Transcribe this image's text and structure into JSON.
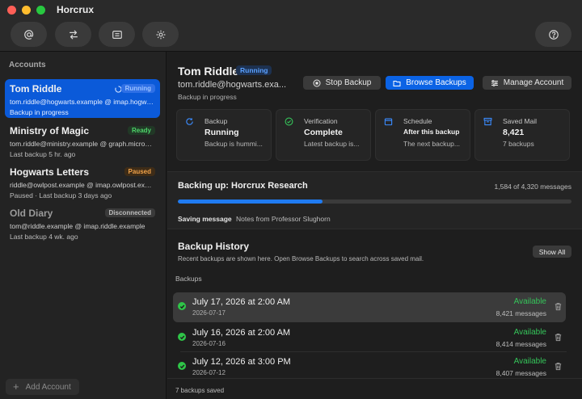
{
  "window": {
    "title": "Horcrux"
  },
  "toolbar": {
    "buttons": [
      {
        "icon": "at-icon"
      },
      {
        "icon": "transfer-icon"
      },
      {
        "icon": "list-icon"
      },
      {
        "icon": "gear-icon"
      },
      {
        "icon": "help-icon"
      }
    ]
  },
  "sidebar": {
    "header": "Accounts",
    "accounts": [
      {
        "name": "Tom Riddle",
        "detail": "tom.riddle@hogwarts.example @ imap.hogwarts.example",
        "sub": "Backup in progress",
        "badge": "Running"
      },
      {
        "name": "Ministry of Magic",
        "detail": "tom.riddle@ministry.example @ graph.microsoft.com",
        "sub": "Last backup 5 hr. ago",
        "badge": "Ready"
      },
      {
        "name": "Hogwarts Letters",
        "detail": "riddle@owlpost.example @ imap.owlpost.example",
        "sub": "Paused · Last backup 3 days ago",
        "badge": "Paused"
      },
      {
        "name": "Old Diary",
        "detail": "tom@riddle.example @ imap.riddle.example",
        "sub": "Last backup 4 wk. ago",
        "badge": "Disconnected"
      }
    ],
    "add_label": "Add Account"
  },
  "detail": {
    "name": "Tom Riddle",
    "status": "Running",
    "email": "tom.riddle@hogwarts.exa...",
    "state": "Backup in progress",
    "actions": {
      "stop": "Stop Backup",
      "browse": "Browse Backups",
      "manage": "Manage Account"
    },
    "cards": [
      {
        "label": "Backup",
        "value": "Running",
        "note": "Backup is hummi..."
      },
      {
        "label": "Verification",
        "value": "Complete",
        "note": "Latest backup is..."
      },
      {
        "label": "Schedule",
        "value": "After this backup",
        "note": "The next backup..."
      },
      {
        "label": "Saved Mail",
        "value": "8,421",
        "note": "7 backups"
      }
    ],
    "progress": {
      "title": "Backing up: Horcrux Research",
      "count": "1,584 of 4,320 messages",
      "fraction": 0.3667,
      "saving_label": "Saving message",
      "saving_value": "Notes from Professor Slughorn"
    },
    "history": {
      "title": "Backup History",
      "description": "Recent backups are shown here. Open Browse Backups to search across saved mail.",
      "show_all": "Show All",
      "section_label": "Backups",
      "rows": [
        {
          "date": "July 17, 2026 at 2:00 AM",
          "iso": "2026-07-17",
          "status": "Available",
          "messages": "8,421 messages"
        },
        {
          "date": "July 16, 2026 at 2:00 AM",
          "iso": "2026-07-16",
          "status": "Available",
          "messages": "8,414 messages"
        },
        {
          "date": "July 12, 2026 at 3:00 PM",
          "iso": "2026-07-12",
          "status": "Available",
          "messages": "8,407 messages"
        }
      ],
      "footer": "7 backups saved"
    }
  },
  "colors": {
    "accent": "#0b63e5",
    "success": "#35c55a",
    "warning": "#f0a24a"
  }
}
